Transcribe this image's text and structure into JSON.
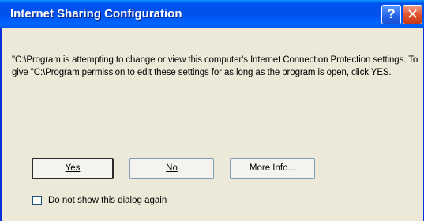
{
  "window": {
    "title": "Internet Sharing Configuration",
    "help_glyph": "?",
    "close_glyph": "✕"
  },
  "message": {
    "text": "\"C:\\Program is attempting to change or view this computer's Internet Connection Protection settings. To give \"C:\\Program permission to edit these settings for as long as the program is open, click YES."
  },
  "buttons": {
    "yes_label": "Yes",
    "no_label": "No",
    "more_info_label": "More Info..."
  },
  "checkbox": {
    "label": "Do not show this dialog again",
    "checked": false
  },
  "colors": {
    "titlebar": "#0055ea",
    "dialog_background": "#ece9d8",
    "close_button": "#e2542d"
  }
}
